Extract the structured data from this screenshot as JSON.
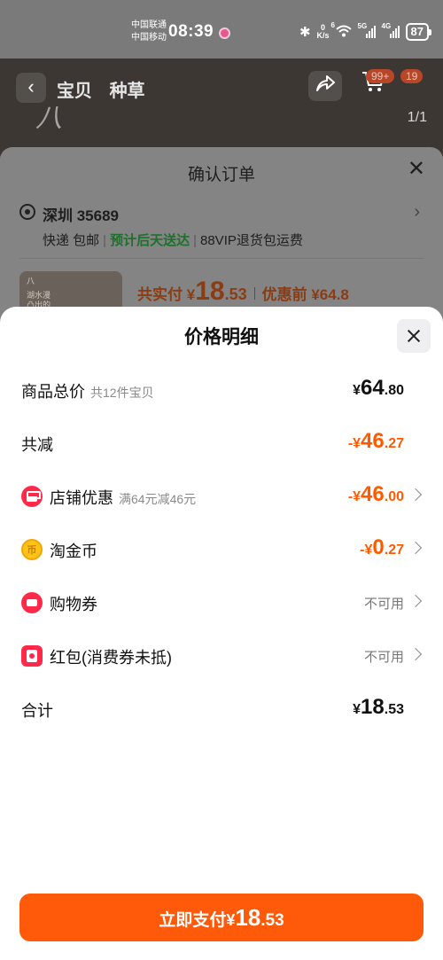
{
  "status_bar": {
    "carrier1": "中国联通",
    "carrier2": "中国移动",
    "time": "08:39",
    "net_speed_value": "0",
    "net_speed_unit": "K/s",
    "wifi_tag": "6",
    "sig1_tag": "5G",
    "sig2_tag": "4G",
    "battery": "87"
  },
  "background_page": {
    "back_glyph": "‹",
    "tabs": [
      "宝贝",
      "种草"
    ],
    "cart_badge": "99+",
    "other_badge": "19",
    "pager": "1/1",
    "logo_text": "八"
  },
  "confirm_order": {
    "title": "确认订单",
    "address": "深圳 35689",
    "delivery": "快递 包邮",
    "delivery_eta": "预计后天送达",
    "vip": "88VIP退货包运费",
    "paid_label": "共实付",
    "paid_currency": "¥",
    "paid_int": "18",
    "paid_dec": ".53",
    "before_label": "优惠前",
    "before_amount": "¥64.8",
    "thumb_line1": "八",
    "thumb_line2": "湖水漫",
    "thumb_line3": "凸出的"
  },
  "price_detail": {
    "title": "价格明细",
    "rows": [
      {
        "label": "商品总价",
        "sub": "共12件宝贝",
        "sign": "",
        "cur": "¥",
        "int": "64",
        "dec": ".80"
      },
      {
        "label": "共减",
        "sub": "",
        "sign": "-",
        "cur": "¥",
        "int": "46",
        "dec": ".27"
      },
      {
        "label": "店铺优惠",
        "sub": "满64元减46元",
        "sign": "-",
        "cur": "¥",
        "int": "46",
        "dec": ".00"
      },
      {
        "label": "淘金币",
        "sub": "",
        "sign": "-",
        "cur": "¥",
        "int": "0",
        "dec": ".27"
      },
      {
        "label": "购物券",
        "sub": "",
        "status": "不可用"
      },
      {
        "label": "红包(消费券未抵)",
        "sub": "",
        "status": "不可用"
      },
      {
        "label": "合计",
        "sub": "",
        "sign": "",
        "cur": "¥",
        "int": "18",
        "dec": ".53"
      }
    ],
    "pay_button": {
      "label": "立即支付",
      "cur": "¥",
      "int": "18",
      "dec": ".53"
    }
  },
  "colors": {
    "accent_orange": "#ff5a00",
    "pay_button": "#ff5a0a",
    "green_eta": "#1f6f2d",
    "icon_red": "#ff2a4a",
    "coin_gold": "#ffc21a"
  },
  "icons": [
    "back-icon",
    "share-icon",
    "cart-icon",
    "close-icon",
    "location-icon",
    "store-icon",
    "coin-icon",
    "ticket-icon",
    "red-packet-icon",
    "chevron-right-icon"
  ]
}
